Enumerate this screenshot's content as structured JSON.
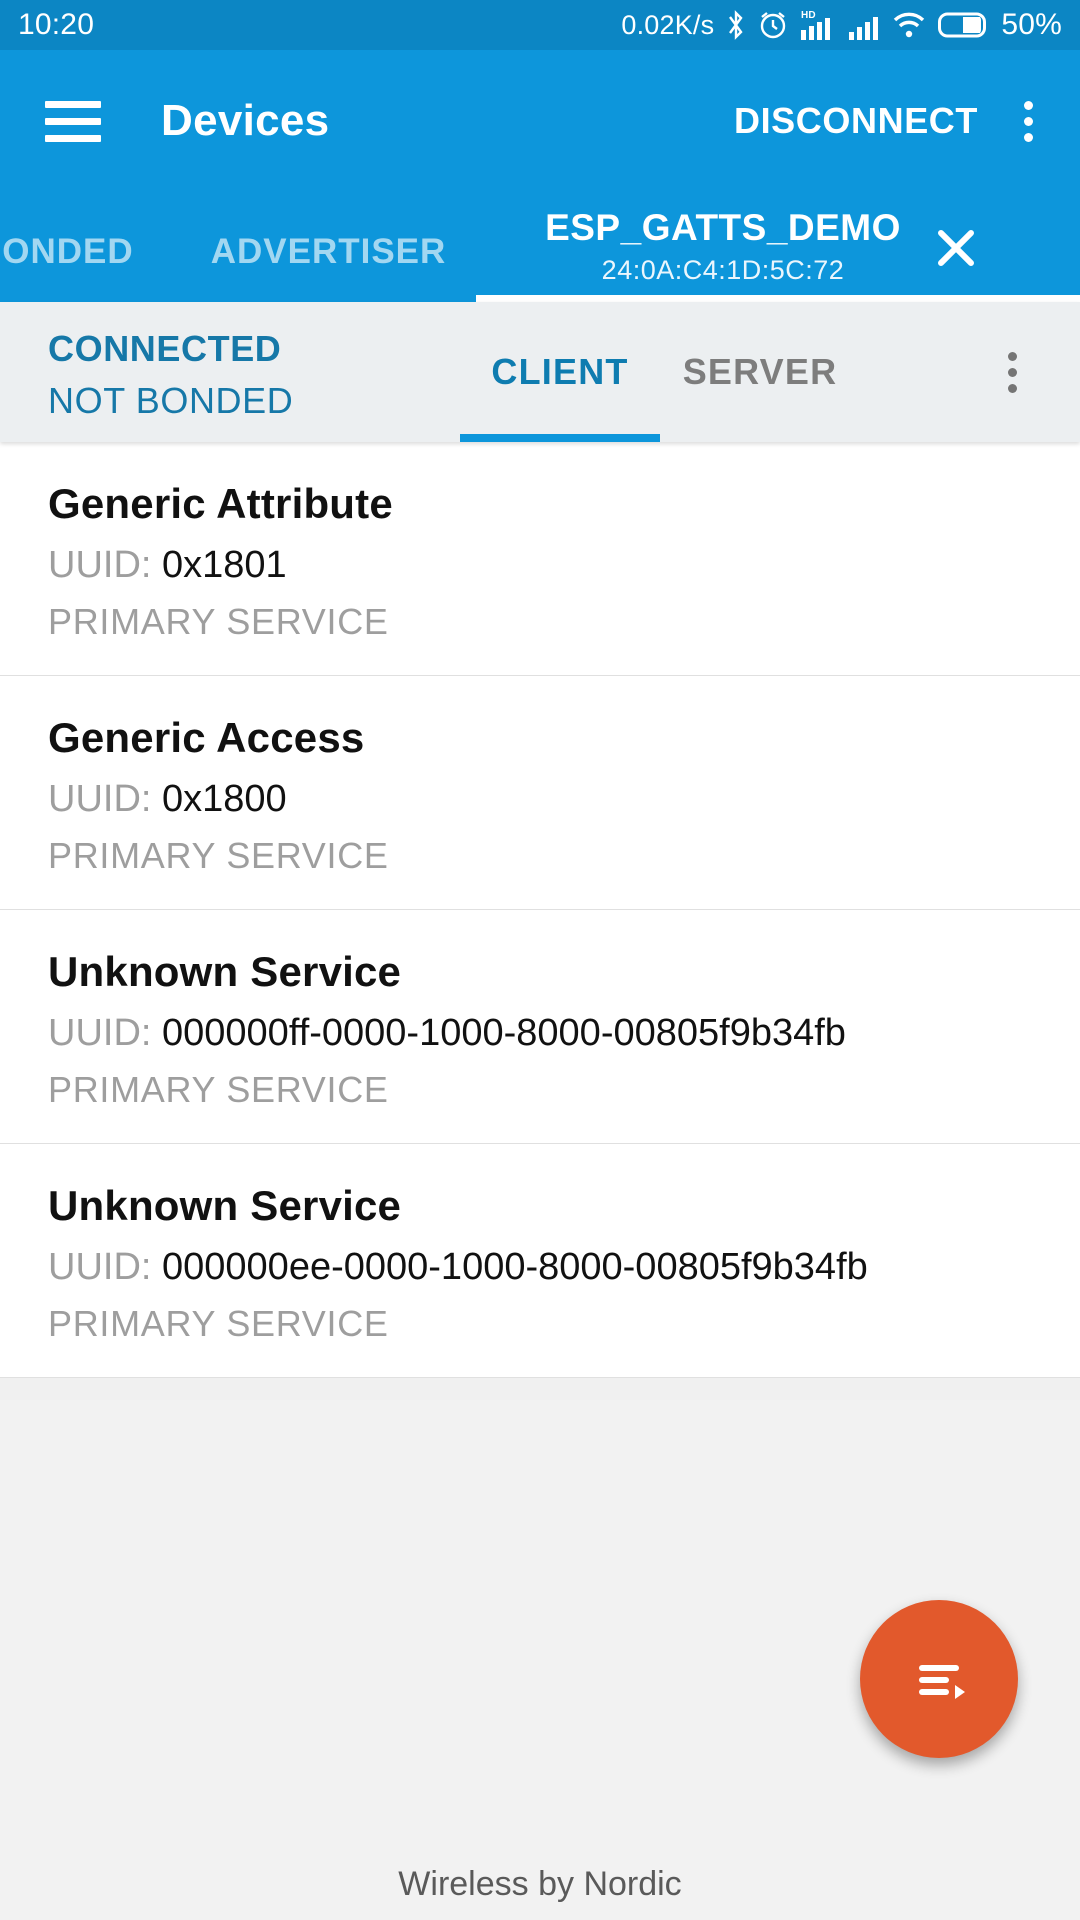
{
  "status_bar": {
    "time": "10:20",
    "network_speed": "0.02K/s",
    "battery_percent": "50%",
    "icons": [
      "bluetooth-icon",
      "alarm-icon",
      "hd-signal-icon",
      "signal-icon",
      "wifi-icon",
      "battery-icon"
    ]
  },
  "app_bar": {
    "menu_icon": "hamburger-menu-icon",
    "title": "Devices",
    "disconnect_label": "DISCONNECT",
    "overflow_icon": "more-vertical-icon"
  },
  "device_tabs": {
    "items": [
      {
        "label": "BONDED",
        "active": false
      },
      {
        "label": "ADVERTISER",
        "active": false
      }
    ],
    "active_device": {
      "name": "ESP_GATTS_DEMO",
      "address": "24:0A:C4:1D:5C:72",
      "close_icon": "close-icon"
    }
  },
  "connection": {
    "state": "CONNECTED",
    "bond_state": "NOT BONDED",
    "tabs": [
      {
        "label": "CLIENT",
        "active": true
      },
      {
        "label": "SERVER",
        "active": false
      }
    ],
    "overflow_icon": "more-vertical-icon"
  },
  "services": [
    {
      "name": "Generic Attribute",
      "uuid_label": "UUID:",
      "uuid": "0x1801",
      "type": "PRIMARY SERVICE"
    },
    {
      "name": "Generic Access",
      "uuid_label": "UUID:",
      "uuid": "0x1800",
      "type": "PRIMARY SERVICE"
    },
    {
      "name": "Unknown Service",
      "uuid_label": "UUID:",
      "uuid": "000000ff-0000-1000-8000-00805f9b34fb",
      "type": "PRIMARY SERVICE"
    },
    {
      "name": "Unknown Service",
      "uuid_label": "UUID:",
      "uuid": "000000ee-0000-1000-8000-00805f9b34fb",
      "type": "PRIMARY SERVICE"
    }
  ],
  "fab": {
    "icon": "log-list-icon"
  },
  "footer": {
    "text": "Wireless by Nordic"
  },
  "colors": {
    "primary": "#0d96db",
    "status_bar": "#0c86c4",
    "accent_blue": "#1678a8",
    "fab": "#e2592c",
    "muted_text": "#9e9e9e"
  }
}
